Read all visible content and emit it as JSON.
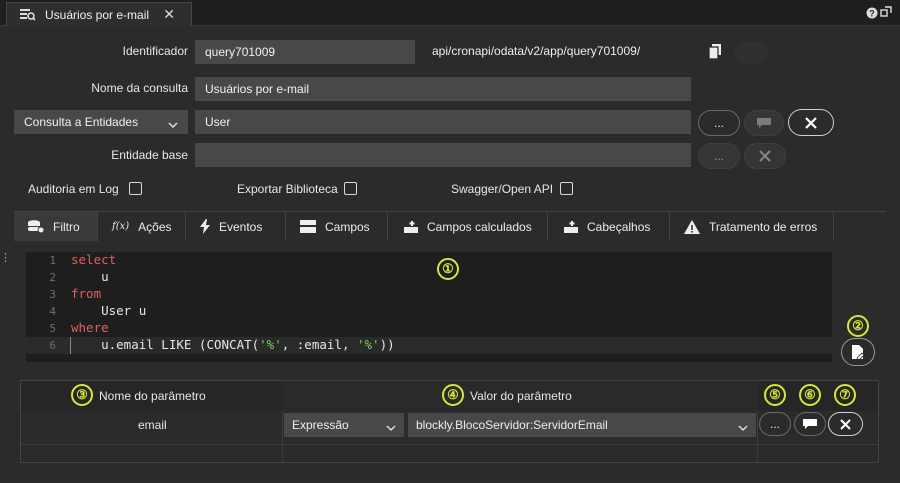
{
  "tab": {
    "title": "Usuários por e-mail",
    "close": "✕"
  },
  "window_icons": [
    "help-icon",
    "restore-icon"
  ],
  "form": {
    "identificador_label": "Identificador",
    "identificador_value": "query701009",
    "endpoint": "api/cronapi/odata/v2/app/query701009/",
    "nome_label": "Nome da consulta",
    "nome_value": "Usuários por e-mail",
    "type_select": "Consulta a Entidades",
    "entity_value": "User",
    "entidade_base_label": "Entidade base",
    "entidade_base_value": "",
    "dots": "...",
    "auditoria_label": "Auditoria em Log",
    "exportar_label": "Exportar Biblioteca",
    "swagger_label": "Swagger/Open API"
  },
  "tabs": [
    {
      "label": "Filtro",
      "icon": "database-icon"
    },
    {
      "label": "Ações",
      "icon": "function-icon"
    },
    {
      "label": "Eventos",
      "icon": "lightning-icon"
    },
    {
      "label": "Campos",
      "icon": "table-icon"
    },
    {
      "label": "Campos calculados",
      "icon": "add-table-icon"
    },
    {
      "label": "Cabeçalhos",
      "icon": "add-table-icon"
    },
    {
      "label": "Tratamento de erros",
      "icon": "warning-icon"
    }
  ],
  "editor": {
    "line_numbers": [
      "1",
      "2",
      "3",
      "4",
      "5",
      "6"
    ],
    "lines": [
      "select",
      "    u",
      "from",
      "    User u",
      "where",
      "    u.email LIKE (CONCAT('%', :email, '%'))"
    ]
  },
  "markers": [
    "①",
    "②",
    "③",
    "④",
    "⑤",
    "⑥",
    "⑦"
  ],
  "params": {
    "col_name": "Nome do parâmetro",
    "col_value": "Valor do parâmetro",
    "rows": [
      {
        "name": "email",
        "type": "Expressão",
        "value": "blockly.BlocoServidor:ServidorEmail",
        "dots": "..."
      }
    ]
  },
  "colors": {
    "accent_marker": "#d8e63a",
    "keyword": "#e06060",
    "string": "#7fd35a"
  }
}
